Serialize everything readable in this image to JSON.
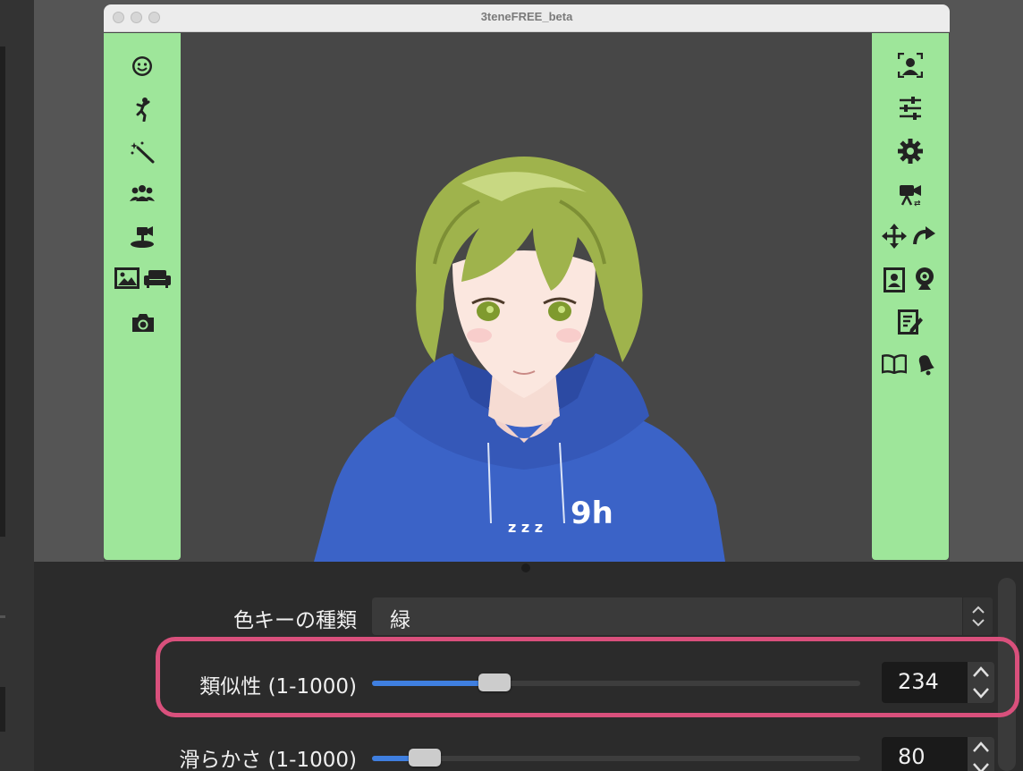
{
  "window": {
    "title": "3teneFREE_beta"
  },
  "left_toolbar": {
    "icons": [
      "face-smile-icon",
      "dance-pose-icon",
      "magic-wand-icon",
      "group-people-icon",
      "camera-stage-icon",
      "image-icon",
      "sofa-icon",
      "camera-icon"
    ]
  },
  "right_toolbar": {
    "icons": [
      "face-tracking-icon",
      "sliders-icon",
      "gear-icon",
      "video-camera-settings-icon",
      "move-arrows-icon",
      "rotate-icon",
      "profile-card-icon",
      "webcam-icon",
      "edit-note-icon",
      "open-book-icon",
      "bell-icon"
    ]
  },
  "controls": {
    "color_key": {
      "label": "色キーの種類",
      "value": "緑"
    },
    "similarity": {
      "label": "類似性 (1-1000)",
      "value": "234",
      "fraction": 0.234
    },
    "smoothness": {
      "label": "滑らかさ (1-1000)",
      "value": "80",
      "fraction": 0.08
    }
  },
  "colors": {
    "toolbar_bg": "#9ee69a",
    "slider_fill": "#3f7fe0",
    "highlight": "#d9507c"
  }
}
